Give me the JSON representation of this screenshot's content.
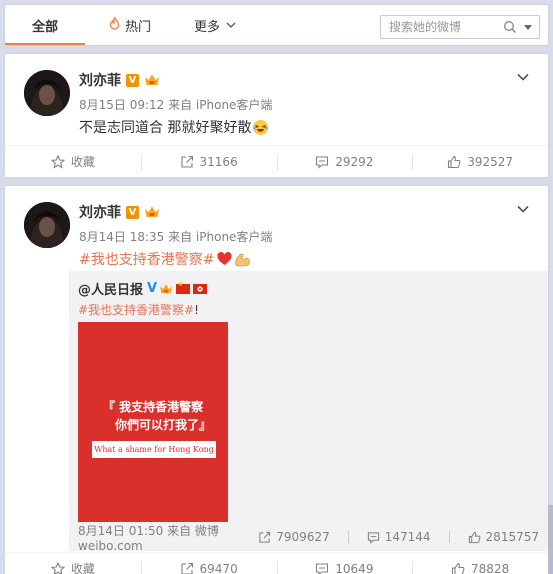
{
  "tabs": {
    "all": "全部",
    "hot": "热门",
    "more": "更多"
  },
  "search": {
    "placeholder": "搜索她的微博"
  },
  "posts": [
    {
      "username": "刘亦菲",
      "meta": "8月15日 09:12 来自 iPhone客户端",
      "text": "不是志同道合 那就好聚好散",
      "actions": {
        "favorite": "收藏",
        "repost": "31166",
        "comment": "29292",
        "like": "392527"
      }
    },
    {
      "username": "刘亦菲",
      "meta": "8月14日 18:35 来自 iPhone客户端",
      "topic": "#我也支持香港警察#",
      "repost": {
        "user": "@人民日报",
        "topic": "#我也支持香港警察#",
        "suffix": "!",
        "poster_line1": "『 我支持香港警察",
        "poster_line2": "你們可以打我了』",
        "poster_banner": "What a shame for Hong Kong",
        "meta": "8月14日 01:50 来自 微博 weibo.com",
        "repost_count": "7909627",
        "comment_count": "147144",
        "like_count": "2815757"
      },
      "actions": {
        "favorite": "收藏",
        "repost": "69470",
        "comment": "10649",
        "like": "78828"
      }
    }
  ],
  "colors": {
    "accent": "#fa7d3c",
    "topic": "#eb7350",
    "background": "#d8dcea",
    "poster_red": "#d9302c"
  }
}
